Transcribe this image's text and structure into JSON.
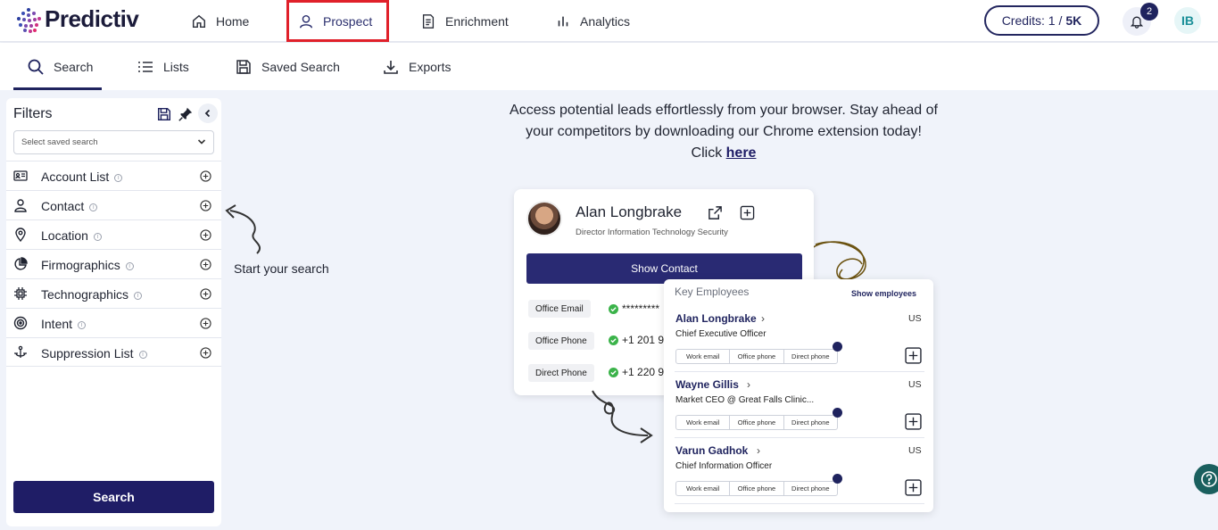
{
  "app": {
    "logo_text": "Predictiv"
  },
  "topnav": {
    "items": [
      {
        "label": "Home",
        "icon": "home-icon"
      },
      {
        "label": "Prospect",
        "icon": "user-icon",
        "active": true
      },
      {
        "label": "Enrichment",
        "icon": "document-icon"
      },
      {
        "label": "Analytics",
        "icon": "bar-chart-icon"
      }
    ],
    "credits_label": "Credits: 1 / ",
    "credits_total": "5K",
    "notifications_count": "2",
    "user_initials": "IB",
    "active_highlight_color": "#e0202a"
  },
  "subnav": {
    "items": [
      {
        "label": "Search",
        "icon": "search-icon",
        "active": true
      },
      {
        "label": "Lists",
        "icon": "list-icon"
      },
      {
        "label": "Saved Search",
        "icon": "save-icon"
      },
      {
        "label": "Exports",
        "icon": "download-icon"
      }
    ]
  },
  "filters": {
    "title": "Filters",
    "saved_search_placeholder": "Select saved search",
    "items": [
      {
        "label": "Account List",
        "icon": "id-card-icon"
      },
      {
        "label": "Contact",
        "icon": "user-icon"
      },
      {
        "label": "Location",
        "icon": "map-pin-icon"
      },
      {
        "label": "Firmographics",
        "icon": "pie-chart-icon"
      },
      {
        "label": "Technographics",
        "icon": "chip-icon"
      },
      {
        "label": "Intent",
        "icon": "target-icon"
      },
      {
        "label": "Suppression List",
        "icon": "suppression-icon"
      }
    ],
    "info_glyph": "i",
    "search_button": "Search"
  },
  "hint": {
    "text": "Start your search"
  },
  "promo": {
    "line1": "Access potential leads effortlessly from your browser. Stay ahead of",
    "line2": "your competitors by downloading our Chrome extension today!",
    "click": "Click ",
    "link": "here"
  },
  "contact_card": {
    "name": "Alan Longbrake",
    "title": "Director Information Technology Security",
    "show_button": "Show Contact",
    "fields": [
      {
        "label": "Office Email",
        "value": "*********"
      },
      {
        "label": "Office Phone",
        "value": "+1 201 9"
      },
      {
        "label": "Direct Phone",
        "value": "+1 220 9"
      }
    ]
  },
  "key_employees": {
    "header": "Key Employees",
    "show_link": "Show employees",
    "chip_labels": [
      "Work email",
      "Office phone",
      "Direct phone"
    ],
    "rows": [
      {
        "name": "Alan Longbrake",
        "country": "US",
        "role": "Chief Executive Officer"
      },
      {
        "name": "Wayne Gillis",
        "country": "US",
        "role": "Market CEO @ Great Falls Clinic..."
      },
      {
        "name": "Varun Gadhok",
        "country": "US",
        "role": "Chief Information Officer"
      }
    ]
  },
  "colors": {
    "brand_navy": "#1f1d66",
    "accent_teal": "#1a5f5e",
    "success_green": "#3bb34a"
  }
}
